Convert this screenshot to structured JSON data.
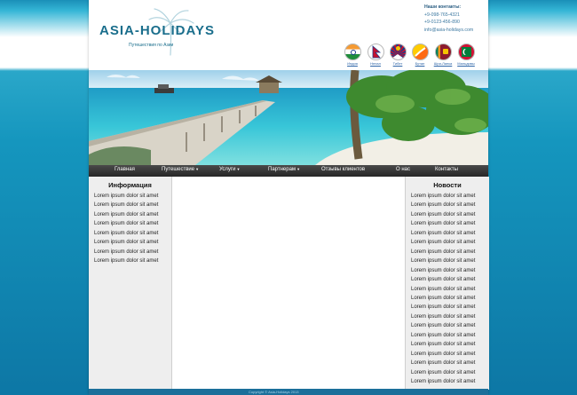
{
  "header": {
    "logo_text": "ASIA-HOLIDAYS",
    "tagline": "Путешествия по Азии",
    "contacts": {
      "title": "Наши контакты:",
      "phone1": "+9-098-765-4321",
      "phone2": "+9-0123-456-890",
      "email": "info@asia-holidays.com"
    },
    "flags": [
      {
        "label": "Индия",
        "icon": "india-flag-icon"
      },
      {
        "label": "Непал",
        "icon": "nepal-flag-icon"
      },
      {
        "label": "Тибет",
        "icon": "tibet-flag-icon"
      },
      {
        "label": "Бутан",
        "icon": "bhutan-flag-icon"
      },
      {
        "label": "Шри-Ланка",
        "icon": "sri-lanka-flag-icon"
      },
      {
        "label": "Мальдивы",
        "icon": "maldives-flag-icon"
      }
    ]
  },
  "nav": {
    "items": [
      {
        "label": "Главная",
        "dropdown": false
      },
      {
        "label": "Путешествие",
        "dropdown": true
      },
      {
        "label": "Услуги",
        "dropdown": true
      },
      {
        "label": "Партнерам",
        "dropdown": true
      },
      {
        "label": "Отзывы клиентов",
        "dropdown": false
      },
      {
        "label": "О нас",
        "dropdown": false
      },
      {
        "label": "Контакты",
        "dropdown": false
      }
    ]
  },
  "sidebar_left": {
    "title": "Информация",
    "items": [
      "Lorem ipsum dolor sit amet",
      "Lorem ipsum dolor sit amet",
      "Lorem ipsum dolor sit amet",
      "Lorem ipsum dolor sit amet",
      "Lorem ipsum dolor sit amet",
      "Lorem ipsum dolor sit amet",
      "Lorem ipsum dolor sit amet",
      "Lorem ipsum dolor sit amet"
    ]
  },
  "sidebar_right": {
    "title": "Новости",
    "items": [
      "Lorem ipsum dolor sit amet",
      "Lorem ipsum dolor sit amet",
      "Lorem ipsum dolor sit amet",
      "Lorem ipsum dolor sit amet",
      "Lorem ipsum dolor sit amet",
      "Lorem ipsum dolor sit amet",
      "Lorem ipsum dolor sit amet",
      "Lorem ipsum dolor sit amet",
      "Lorem ipsum dolor sit amet",
      "Lorem ipsum dolor sit amet",
      "Lorem ipsum dolor sit amet",
      "Lorem ipsum dolor sit amet",
      "Lorem ipsum dolor sit amet",
      "Lorem ipsum dolor sit amet",
      "Lorem ipsum dolor sit amet",
      "Lorem ipsum dolor sit amet",
      "Lorem ipsum dolor sit amet",
      "Lorem ipsum dolor sit amet",
      "Lorem ipsum dolor sit amet",
      "Lorem ipsum dolor sit amet",
      "Lorem ipsum dolor sit amet"
    ]
  },
  "footer": {
    "text": "Copyright © Asia-Holidays 2013"
  },
  "colors": {
    "accent": "#1a6e8c",
    "nav_bg": "#2e2e2e",
    "sidebar_bg": "#eeeeee",
    "page_bg_top": "#35b6d6",
    "page_bg_bottom": "#0d77a5"
  }
}
